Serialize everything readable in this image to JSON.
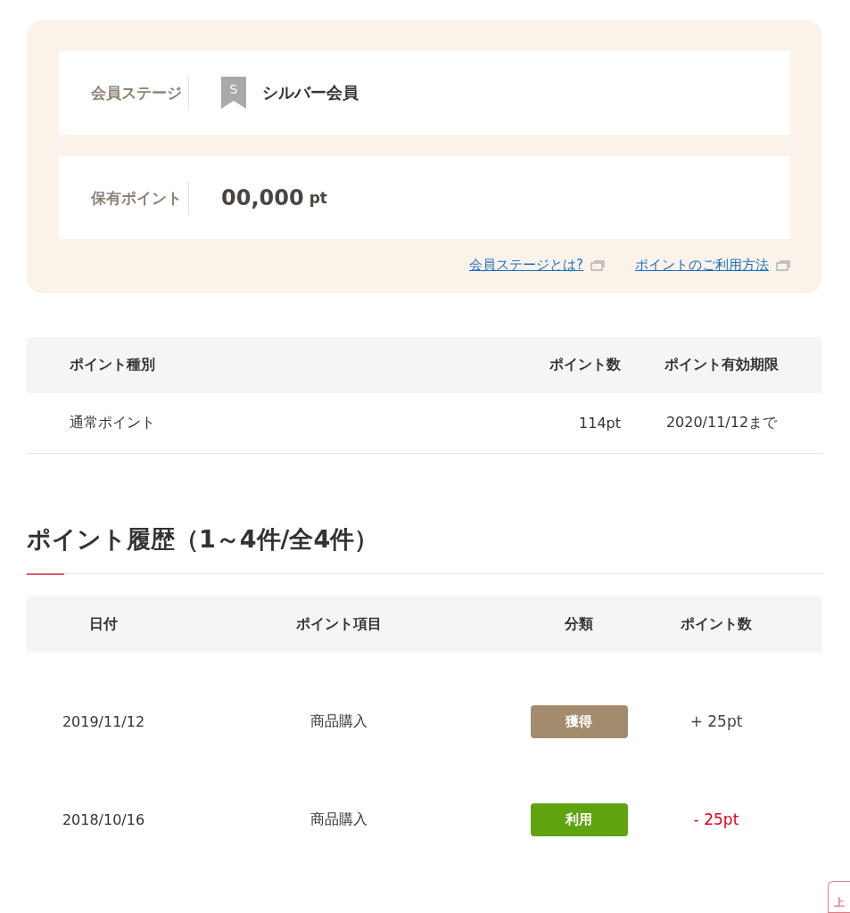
{
  "member": {
    "rows": [
      {
        "label": "会員ステージ",
        "kind": "stage",
        "badge": "S",
        "value": "シルバー会員"
      },
      {
        "label": "保有ポイント",
        "kind": "points",
        "value": "00,000",
        "unit": "pt"
      }
    ],
    "links": [
      "会員ステージとは?",
      "ポイントのご利用方法"
    ]
  },
  "point_table": {
    "columns": [
      "ポイント種別",
      "ポイント数",
      "ポイント有効期限"
    ],
    "rows": [
      [
        "通常ポイント",
        "114pt",
        "2020/11/12まで"
      ]
    ]
  },
  "history": {
    "title": "ポイント履歴（1～4件/全4件）",
    "columns": [
      "日付",
      "ポイント項目",
      "分類",
      "ポイント数"
    ],
    "rows": [
      {
        "date": "2019/11/12",
        "item": "商品購入",
        "category": "獲得",
        "kind": "earn",
        "points": "+ 25pt"
      },
      {
        "date": "2018/10/16",
        "item": "商品購入",
        "category": "利用",
        "kind": "use",
        "points": "- 25pt"
      }
    ]
  },
  "back_to_top": {
    "label": "上"
  }
}
